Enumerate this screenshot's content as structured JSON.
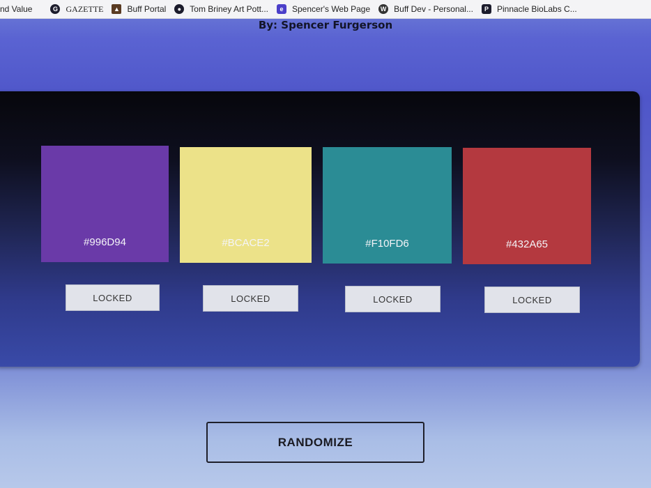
{
  "bookmarks": [
    {
      "label": "nd Value",
      "icon": ""
    },
    {
      "label": "GAZETTE",
      "icon": "gazette-icon"
    },
    {
      "label": "Buff Portal",
      "icon": "buffalo-icon"
    },
    {
      "label": "Tom Briney Art Pott...",
      "icon": "globe-icon"
    },
    {
      "label": "Spencer's Web Page",
      "icon": "site-icon"
    },
    {
      "label": "Buff Dev - Personal...",
      "icon": "wordpress-icon"
    },
    {
      "label": "Pinnacle BioLabs C...",
      "icon": "p-icon"
    }
  ],
  "byline": "By: Spencer Furgerson",
  "swatches": [
    {
      "hex_label": "#996D94",
      "color": "#6a3aa8"
    },
    {
      "hex_label": "#BCACE2",
      "color": "#ece289"
    },
    {
      "hex_label": "#F10FD6",
      "color": "#2b8c95"
    },
    {
      "hex_label": "#432A65",
      "color": "#b4393f"
    }
  ],
  "lock_buttons": [
    "LOCKED",
    "LOCKED",
    "LOCKED",
    "LOCKED"
  ],
  "randomize_label": "RANDOMIZE"
}
